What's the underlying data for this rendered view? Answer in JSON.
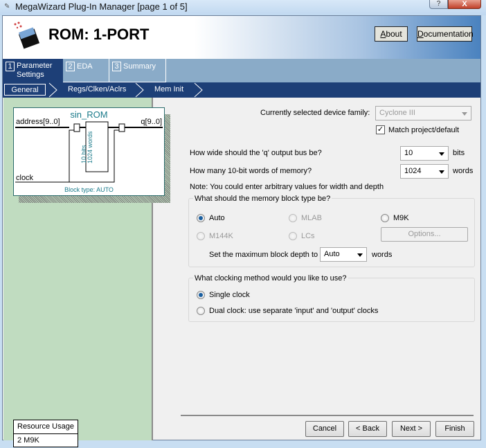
{
  "window": {
    "title": "MegaWizard Plug-In Manager [page 1 of 5]",
    "help": "?",
    "close": "X"
  },
  "header": {
    "title": "ROM: 1-PORT",
    "about": "About",
    "documentation": "Documentation"
  },
  "tabs": [
    {
      "num": "1",
      "label": "Parameter Settings"
    },
    {
      "num": "2",
      "label": "EDA"
    },
    {
      "num": "3",
      "label": "Summary"
    }
  ],
  "subtabs": [
    "General",
    "Regs/Clken/Aclrs",
    "Mem Init"
  ],
  "symbol": {
    "name": "sin_ROM",
    "address": "address[9..0]",
    "q": "q[9..0]",
    "clock": "clock",
    "bits": "10 bits",
    "words": "1024 words",
    "block_type": "Block type: AUTO"
  },
  "resource": {
    "title": "Resource Usage",
    "value": "2 M9K"
  },
  "form": {
    "device_label": "Currently selected device family:",
    "device_value": "Cyclone III",
    "match_label": "Match project/default",
    "match_checked": true,
    "width_label": "How wide should the 'q' output bus be?",
    "width_value": "10",
    "width_unit": "bits",
    "depth_label": "How many 10-bit words of memory?",
    "depth_value": "1024",
    "depth_unit": "words",
    "note": "Note: You could enter arbitrary values for width and depth",
    "block_group": "What should the memory block type be?",
    "block_options": [
      "Auto",
      "MLAB",
      "M9K",
      "M144K",
      "LCs"
    ],
    "block_selected": "Auto",
    "options_button": "Options...",
    "max_depth_label": "Set the maximum block depth to",
    "max_depth_value": "Auto",
    "max_depth_unit": "words",
    "clock_group": "What clocking method would you like to use?",
    "clock_options": [
      "Single clock",
      "Dual clock: use separate 'input' and 'output' clocks"
    ],
    "clock_selected": "Single clock"
  },
  "footer": {
    "cancel": "Cancel",
    "back": "< Back",
    "next": "Next >",
    "finish": "Finish"
  }
}
